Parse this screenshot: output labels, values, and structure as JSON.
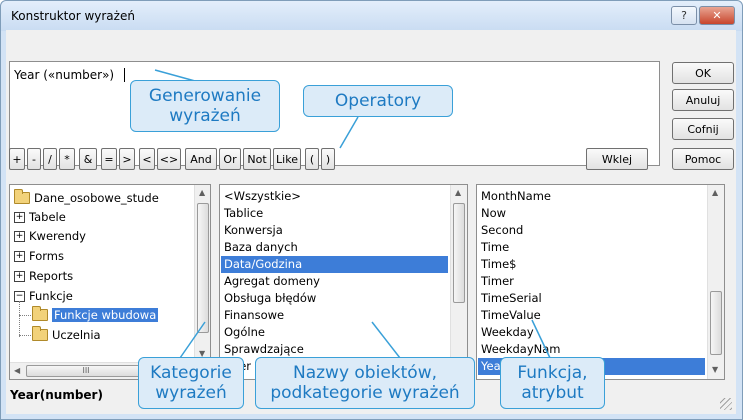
{
  "window": {
    "title": "Konstruktor wyrażeń",
    "help_label": "?",
    "close_label": "✕"
  },
  "expression": {
    "text": "Year («number»)"
  },
  "side_buttons": {
    "ok": "OK",
    "cancel": "Anuluj",
    "undo": "Cofnij",
    "help": "Pomoc"
  },
  "paste_button": "Wklej",
  "operators": [
    "+",
    "-",
    "/",
    "*",
    "&",
    "=",
    ">",
    "<",
    "<>",
    "And",
    "Or",
    "Not",
    "Like",
    "(",
    ")"
  ],
  "tree": {
    "items": [
      {
        "label": "Dane_osobowe_stude",
        "type": "folder"
      },
      {
        "label": "Tabele",
        "type": "plus"
      },
      {
        "label": "Kwerendy",
        "type": "plus"
      },
      {
        "label": "Forms",
        "type": "plus"
      },
      {
        "label": "Reports",
        "type": "plus"
      },
      {
        "label": "Funkcje",
        "type": "minus"
      },
      {
        "label": "Funkcje wbudowa",
        "type": "open-folder",
        "selected": true
      },
      {
        "label": "Uczelnia",
        "type": "folder"
      }
    ],
    "hscroll_label": "III"
  },
  "categories": {
    "items": [
      "<Wszystkie>",
      "Tablice",
      "Konwersja",
      "Baza danych",
      "Data/Godzina",
      "Agregat domeny",
      "Obsługa błędów",
      "Finansowe",
      "Ogólne",
      "Sprawdzające",
      "Inter"
    ],
    "selected_index": 4
  },
  "functions": {
    "items": [
      "MonthName",
      "Now",
      "Second",
      "Time",
      "Time$",
      "Timer",
      "TimeSerial",
      "TimeValue",
      "Weekday",
      "WeekdayNam",
      "Year"
    ],
    "selected_index": 10
  },
  "status_text": "Year(number)",
  "callouts": {
    "generowanie_line1": "Generowanie",
    "generowanie_line2": "wyrażeń",
    "operatory": "Operatory",
    "kategorie_line1": "Kategorie",
    "kategorie_line2": "wyrażeń",
    "nazwy_line1": "Nazwy obiektów,",
    "nazwy_line2": "podkategorie wyrażeń",
    "funkcja_line1": "Funkcja,",
    "funkcja_line2": "atrybut"
  },
  "colors": {
    "selection": "#3d7dd8",
    "callout_border": "#3aa0d8",
    "callout_text": "#1e7ac2",
    "close_button": "#c8462d"
  }
}
